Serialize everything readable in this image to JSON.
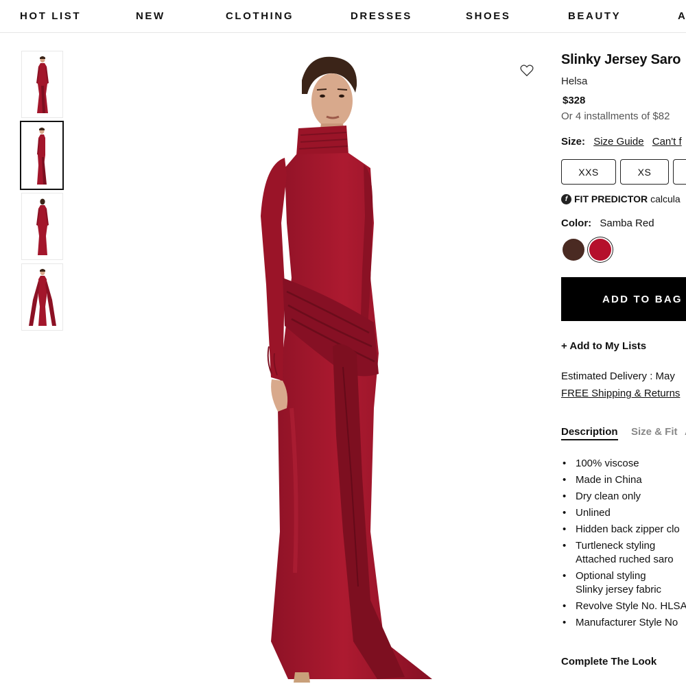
{
  "nav": {
    "items": [
      "HOT LIST",
      "NEW",
      "CLOTHING",
      "DRESSES",
      "SHOES",
      "BEAUTY",
      "A"
    ]
  },
  "product": {
    "title": "Slinky Jersey Saro",
    "brand": "Helsa",
    "price": "$328",
    "installments": "Or 4 installments of $82",
    "size_label": "Size:",
    "size_guide": "Size Guide",
    "cant_find": "Can't f",
    "sizes": [
      "XXS",
      "XS"
    ],
    "fit_predictor_label": "FIT PREDICTOR",
    "fit_predictor_text": "calcula",
    "fit_icon_glyph": "f",
    "color_label": "Color:",
    "color_value": "Samba Red",
    "swatches": [
      {
        "name": "brown",
        "hex": "#4a2a22"
      },
      {
        "name": "samba-red",
        "hex": "#b5102c"
      }
    ],
    "add_to_bag": "ADD TO BAG",
    "add_to_lists": "+ Add to My Lists",
    "delivery": "Estimated Delivery : May",
    "shipping": "FREE Shipping & Returns",
    "tabs": [
      "Description",
      "Size & Fit",
      "A"
    ],
    "description": [
      "100% viscose",
      "Made in China",
      "Dry clean only",
      "Unlined",
      "Hidden back zipper clo",
      "Turtleneck styling",
      "Attached ruched saro",
      "Optional styling",
      "Slinky jersey fabric",
      "Revolve Style No. HLSA",
      "Manufacturer Style No"
    ],
    "complete_look": "Complete The Look"
  },
  "colors": {
    "dress": "#a3162b",
    "dress_shadow": "#7d0f20",
    "skin": "#d8a98c",
    "hair": "#3b2418"
  },
  "icons": {
    "wishlist": "heart-icon",
    "fit": "fit-predictor-icon"
  }
}
